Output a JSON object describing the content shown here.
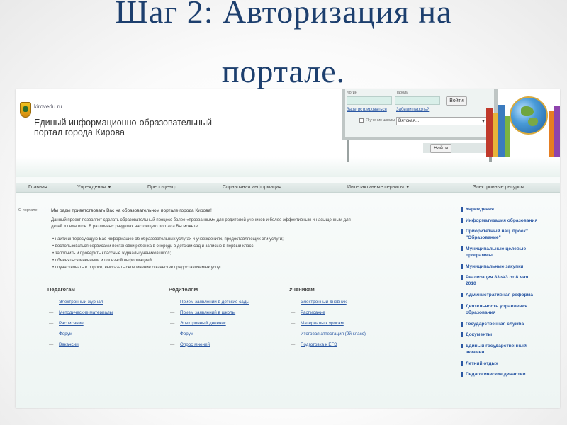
{
  "slide": {
    "title_line1": "Шаг 2: Авторизация на",
    "title_line2": "портале."
  },
  "site": {
    "domain": "kirovedu.ru",
    "name_line1": "Единый информационно-образовательный",
    "name_line2": "портал города Кирова"
  },
  "login": {
    "login_label": "Логин",
    "password_label": "Пароль",
    "login_button": "Войти",
    "register_link": "Зарегистрироваться",
    "forgot_link": "Забыли пароль?",
    "school_checkbox_label": "Я ученик школы",
    "school_select_value": "Вятская...",
    "search_button": "Найти"
  },
  "nav": {
    "items": [
      "Главная",
      "Учреждения ▼",
      "Пресс-центр",
      "Справочная информация",
      "Интерактивные сервисы ▼",
      "Электронные ресурсы"
    ]
  },
  "content": {
    "breadcrumb": "О портале",
    "welcome": "Мы рады приветствовать Вас на образовательном портале города Кирова!",
    "intro_line1": "Данный проект позволяет сделать образовательный процесс более «прозрачным» для родителей учеников и более эффективным и насыщенным для",
    "intro_line2": "детей и педагогов. В различных разделах настоящего портала Вы можете:",
    "bullets": [
      "найти интересующую Вас информацию об образовательных услугах и учреждениях, предоставляющих эти услуги;",
      "воспользоваться сервисами постановки ребенка в очередь в детский сад и записью в первый класс;",
      "заполнить и проверить классные журналы учеников школ;",
      "обменяться мнениями и полезной информацией;",
      "поучаствовать в опросе, высказать свое мнение о качестве предоставляемых услуг."
    ]
  },
  "columns": {
    "teachers": {
      "heading": "Педагогам",
      "items": [
        "Электронный журнал",
        "Методические материалы",
        "Расписание",
        "Форум",
        "Вакансии"
      ]
    },
    "parents": {
      "heading": "Родителям",
      "items": [
        "Прием заявлений в детские сады",
        "Прием заявлений в школы",
        "Электронный дневник",
        "Форум",
        "Опрос мнений"
      ]
    },
    "students": {
      "heading": "Ученикам",
      "items": [
        "Электронный дневник",
        "Расписание",
        "Материалы к урокам",
        "Итоговая аттестация (9й класс)",
        "Подготовка к ЕГЭ"
      ]
    }
  },
  "sidebar": {
    "items": [
      [
        "Учреждения"
      ],
      [
        "Информатизация образования"
      ],
      [
        "Приоритетный нац. проект",
        "\"Образование\""
      ],
      [
        "Муниципальные целевые",
        "программы"
      ],
      [
        "Муниципальные закупки"
      ],
      [
        "Реализация 83-ФЗ от 8 мая",
        "2010"
      ],
      [
        "Административная реформа"
      ],
      [
        "Деятельность управления",
        "образования"
      ],
      [
        "Государственная служба"
      ],
      [
        "Документы"
      ],
      [
        "Единый государственный",
        "экзамен"
      ],
      [
        "Летний отдых"
      ],
      [
        "Педагогические династии"
      ]
    ]
  },
  "colors": {
    "title": "#1d3f6e",
    "link": "#2a57a3",
    "nav_bg": "#d7e2df"
  },
  "icons": {
    "logo": "coat-of-arms-icon",
    "decor": "globe-books-icon"
  }
}
